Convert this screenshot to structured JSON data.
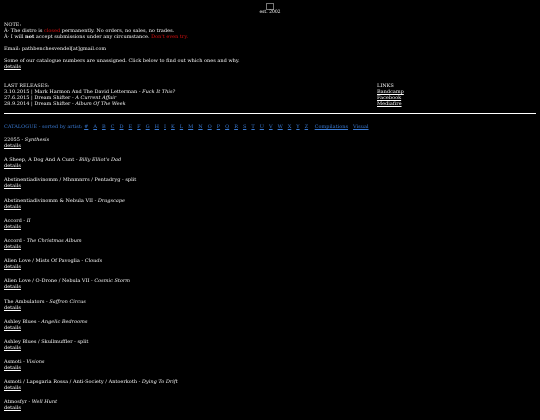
{
  "header": {
    "logo_alt": "logo",
    "est": "est. 2002"
  },
  "notes": {
    "heading": "NOTE:",
    "line1_pre": "Â· The distro is ",
    "line1_red": "closed",
    "line1_post": " permanently. No orders, no sales, no trades.",
    "line2_pre": "Â· I will ",
    "line2_bold": "not",
    "line2_mid": " accept submissions under any circumstance. ",
    "line2_red": "Don't even try.",
    "email": "Email: pathbenchesvendel[at]gmail.com",
    "missing": "Some of our catalogue numbers are unassigned. Click below to find out which ones and why.",
    "details": "details"
  },
  "latest": {
    "heading": "LAST RELEASES:",
    "items": [
      {
        "date": "3.10.2015",
        "artist": "Mark Harmon And The David Letterman",
        "title": "Fuck It This?"
      },
      {
        "date": "27.6.2015",
        "artist": "Dream Shifter",
        "title": "A Current Affair"
      },
      {
        "date": "28.9.2014",
        "artist": "Dream Shifter",
        "title": "Album Of The Week"
      }
    ]
  },
  "links": {
    "heading": "LINKS",
    "items": [
      "Bandcamp",
      "Facebook",
      "Mediafire"
    ]
  },
  "catbar": {
    "label": "CATALOGUE - sorted by artist:",
    "letters": [
      "#",
      "A",
      "B",
      "C",
      "D",
      "E",
      "F",
      "G",
      "H",
      "I",
      "K",
      "L",
      "M",
      "N",
      "O",
      "P",
      "Q",
      "R",
      "S",
      "T",
      "U",
      "V",
      "W",
      "X",
      "Y",
      "Z"
    ],
    "extra": [
      "Compilations",
      "Visual"
    ]
  },
  "catalogue": [
    {
      "artist": "22055",
      "title": "Synthesis",
      "details": "details"
    },
    {
      "artist": "A Sheep, A Dog And A Cunt",
      "title": "Billy Elliot's Dad",
      "details": "details"
    },
    {
      "artist": "Abstinentiadivinomm / Mhnmnrrs / Pentadryg",
      "title": "split",
      "details": "details",
      "plain": true
    },
    {
      "artist": "Abstinentiadivinomm & Nebula VII",
      "title": "Dragscape",
      "details": "details"
    },
    {
      "artist": "Accord",
      "title": "II",
      "details": "details"
    },
    {
      "artist": "Accord",
      "title": "The Christmas Album",
      "details": "details"
    },
    {
      "artist": "Alien Love / Mists Of Pavoglia",
      "title": "Clouds",
      "details": "details"
    },
    {
      "artist": "Alien Love / O-Drone / Nebula VII",
      "title": "Cosmic Storm",
      "details": "details"
    },
    {
      "artist": "The Ambulators",
      "title": "Saffron Circus",
      "details": "details"
    },
    {
      "artist": "Ashley Blues",
      "title": "Angelic Bedrooms",
      "details": "details"
    },
    {
      "artist": "Ashley Blues / Skullmuffler",
      "title": "split",
      "details": "details",
      "plain": true
    },
    {
      "artist": "Asmoti",
      "title": "Visions",
      "details": "details"
    },
    {
      "artist": "Asmoti / Lapsgaria Rossa / Anti-Society / Antoerkoth",
      "title": "Dying To Drift",
      "details": "details"
    },
    {
      "artist": "Atmosfyr",
      "title": "Well Hunt",
      "details": "details"
    }
  ],
  "colors": {
    "background": "#000000",
    "text": "#ffffff",
    "alert": "#e01010",
    "catbar": "#3a7bd5"
  }
}
